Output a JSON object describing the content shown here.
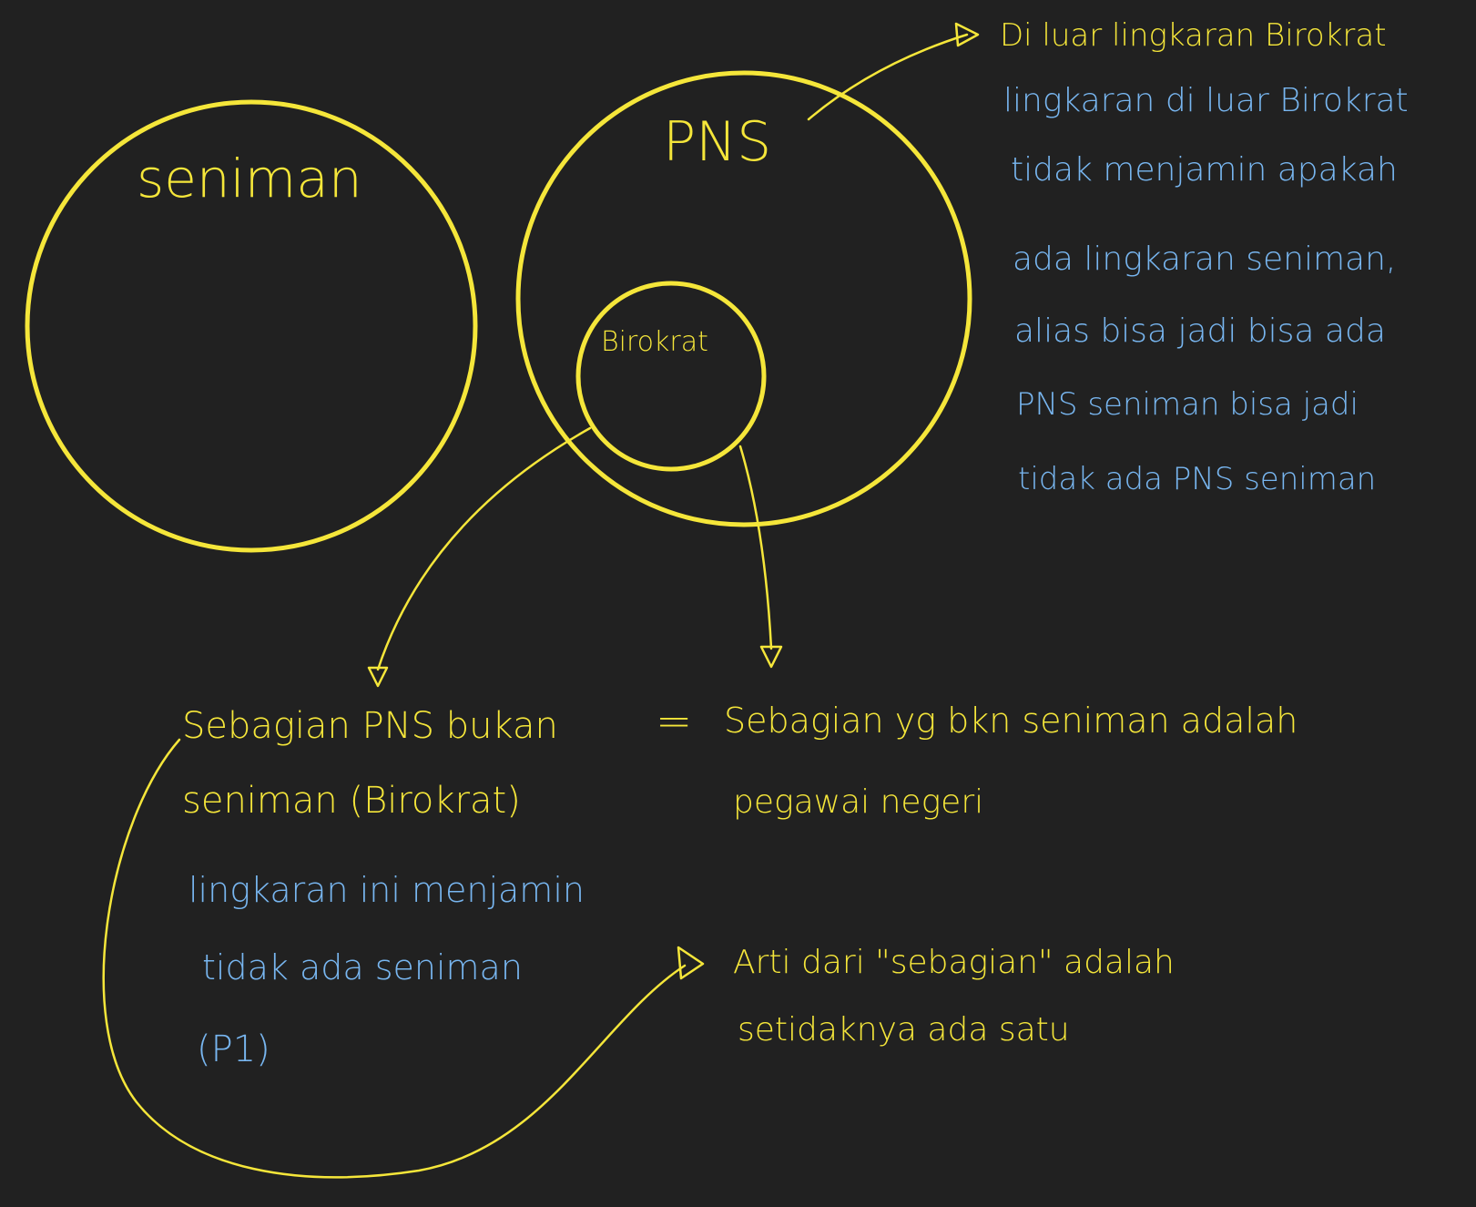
{
  "colors": {
    "background": "#212121",
    "yellow": "#f5e63a",
    "blue": "#78b6f0"
  },
  "circles": {
    "seniman_label": "seniman",
    "pns_label": "PNS",
    "birokrat_label": "Birokrat"
  },
  "top_right_note": {
    "heading": "Di luar lingkaran Birokrat",
    "lines": [
      "lingkaran di luar Birokrat",
      "tidak menjamin apakah",
      "ada lingkaran seniman,",
      "alias bisa jadi bisa ada",
      "PNS seniman bisa jadi",
      "tidak ada PNS seniman"
    ]
  },
  "statement": {
    "line1": "Sebagian PNS bukan",
    "line2": "seniman (Birokrat)",
    "equals": "=",
    "equiv_line1": "Sebagian yg bkn seniman adalah",
    "equiv_line2": "pegawai negeri"
  },
  "p1_note": {
    "lines": [
      "lingkaran ini menjamin",
      "tidak ada seniman",
      "(P1)"
    ]
  },
  "meaning_note": {
    "line1": "Arti dari \"sebagian\" adalah",
    "line2": "setidaknya ada satu"
  }
}
